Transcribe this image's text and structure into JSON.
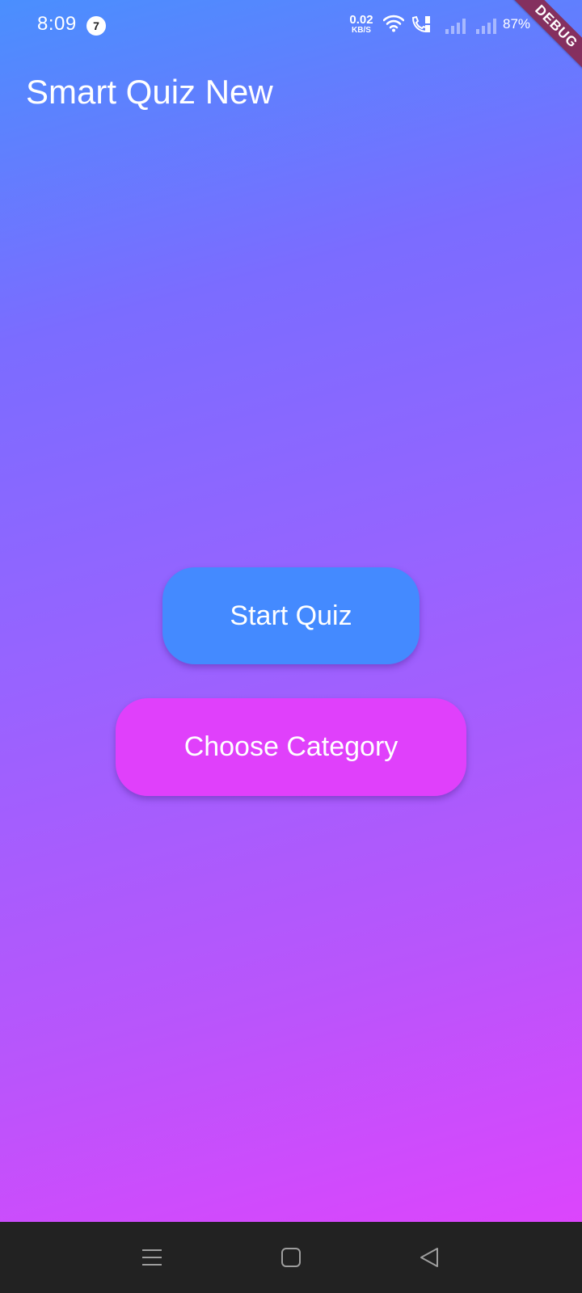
{
  "status_bar": {
    "time": "8:09",
    "notification_count": "7",
    "net_speed_value": "0.02",
    "net_speed_unit": "KB/S",
    "battery": "87%",
    "icons": [
      "wifi-icon",
      "wifi-calling-icon",
      "signal-sim1-icon",
      "signal-sim2-icon",
      "battery-icon"
    ]
  },
  "debug_banner": "DEBUG",
  "app": {
    "title": "Smart Quiz New",
    "start_label": "Start Quiz",
    "category_label": "Choose Category"
  },
  "nav_bar": {
    "icons": [
      "menu-icon",
      "home-icon",
      "back-icon"
    ]
  },
  "colors": {
    "gradient_start": "#4a8ffe",
    "gradient_end": "#dc45fc",
    "start_button": "#448aff",
    "category_button": "#e040fb",
    "nav_bar": "#222222"
  }
}
